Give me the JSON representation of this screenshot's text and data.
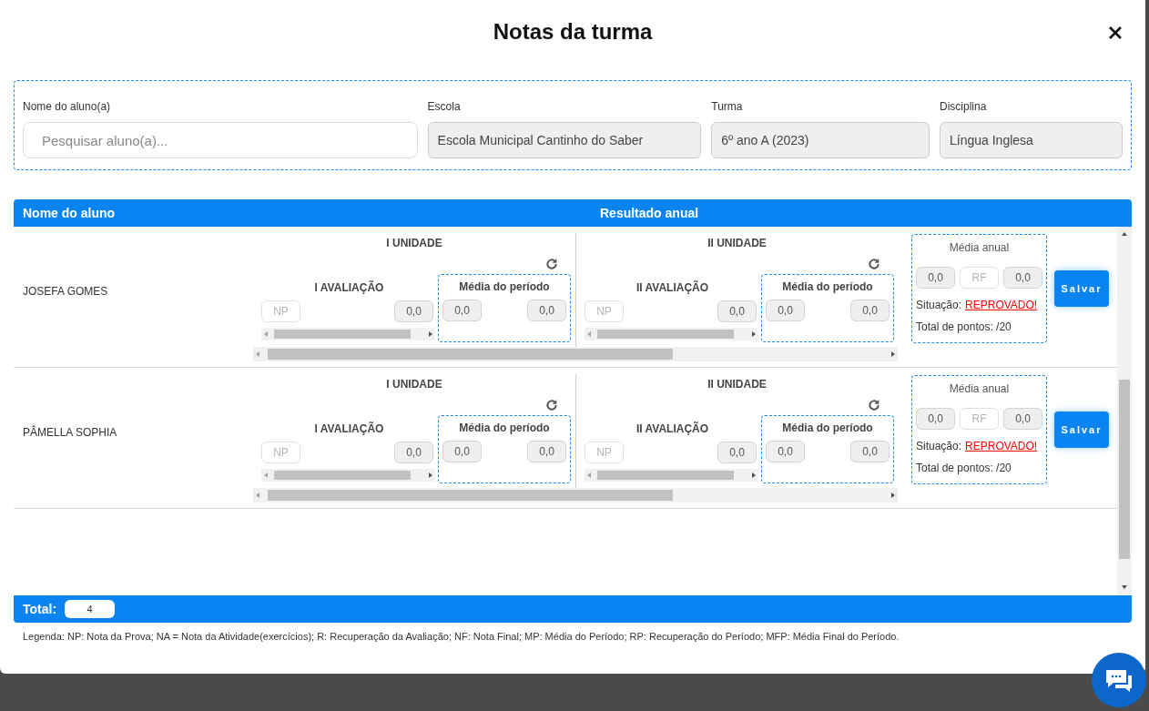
{
  "dialog": {
    "title": "Notas da turma"
  },
  "filters": [
    {
      "kind": "search",
      "label": "Nome do aluno(a)",
      "placeholder": "Pesquisar aluno(a)..."
    },
    {
      "kind": "readonly",
      "label": "Escola",
      "value": "Escola Municipal Cantinho do Saber"
    },
    {
      "kind": "readonly",
      "label": "Turma",
      "value": "6º ano A (2023)"
    },
    {
      "kind": "readonly",
      "label": "Disciplina",
      "value": "Língua Inglesa"
    }
  ],
  "table": {
    "columns": [
      "Nome do aluno",
      "Resultado anual"
    ],
    "rows": [
      {
        "name": "JOSEFA GOMES",
        "units": [
          {
            "title": "I UNIDADE",
            "evaluation": "I AVALIAÇÃO",
            "np_placeholder": "NP",
            "grade": "0,0",
            "period_title": "Média do período",
            "period_values": [
              "0,0",
              "0,0"
            ]
          },
          {
            "title": "II UNIDADE",
            "evaluation": "II AVALIAÇÃO",
            "np_placeholder": "NP",
            "grade": "0,0",
            "period_title": "Média do período",
            "period_values": [
              "0,0",
              "0,0"
            ]
          }
        ],
        "annual": {
          "title": "Média anual",
          "fields": [
            {
              "kind": "readonly",
              "value": "0,0"
            },
            {
              "kind": "input",
              "placeholder": "RF"
            },
            {
              "kind": "readonly",
              "value": "0,0"
            }
          ],
          "status_label": "Situação:",
          "status": "REPROVADO!",
          "total": "Total de pontos: /20"
        },
        "save": "Salvar"
      },
      {
        "name": "PÂMELLA SOPHIA",
        "units": [
          {
            "title": "I UNIDADE",
            "evaluation": "I AVALIAÇÃO",
            "np_placeholder": "NP",
            "grade": "0,0",
            "period_title": "Média do período",
            "period_values": [
              "0,0",
              "0,0"
            ]
          },
          {
            "title": "II UNIDADE",
            "evaluation": "II AVALIAÇÃO",
            "np_placeholder": "NP",
            "grade": "0,0",
            "period_title": "Média do período",
            "period_values": [
              "0,0",
              "0,0"
            ]
          }
        ],
        "annual": {
          "title": "Média anual",
          "fields": [
            {
              "kind": "readonly",
              "value": "0,0"
            },
            {
              "kind": "input",
              "placeholder": "RF"
            },
            {
              "kind": "readonly",
              "value": "0,0"
            }
          ],
          "status_label": "Situação:",
          "status": "REPROVADO!",
          "total": "Total de pontos: /20"
        },
        "save": "Salvar"
      }
    ]
  },
  "footer": {
    "total_label": "Total:",
    "total": "4"
  },
  "legend": "Legenda: NP: Nota da Prova; NA = Nota da Atividade(exercícios); R: Recuperação da Avaliação; NF: Nota Final; MP: Média do Período; RP: Recuperação do Período; MFP: Média Final do Período."
}
